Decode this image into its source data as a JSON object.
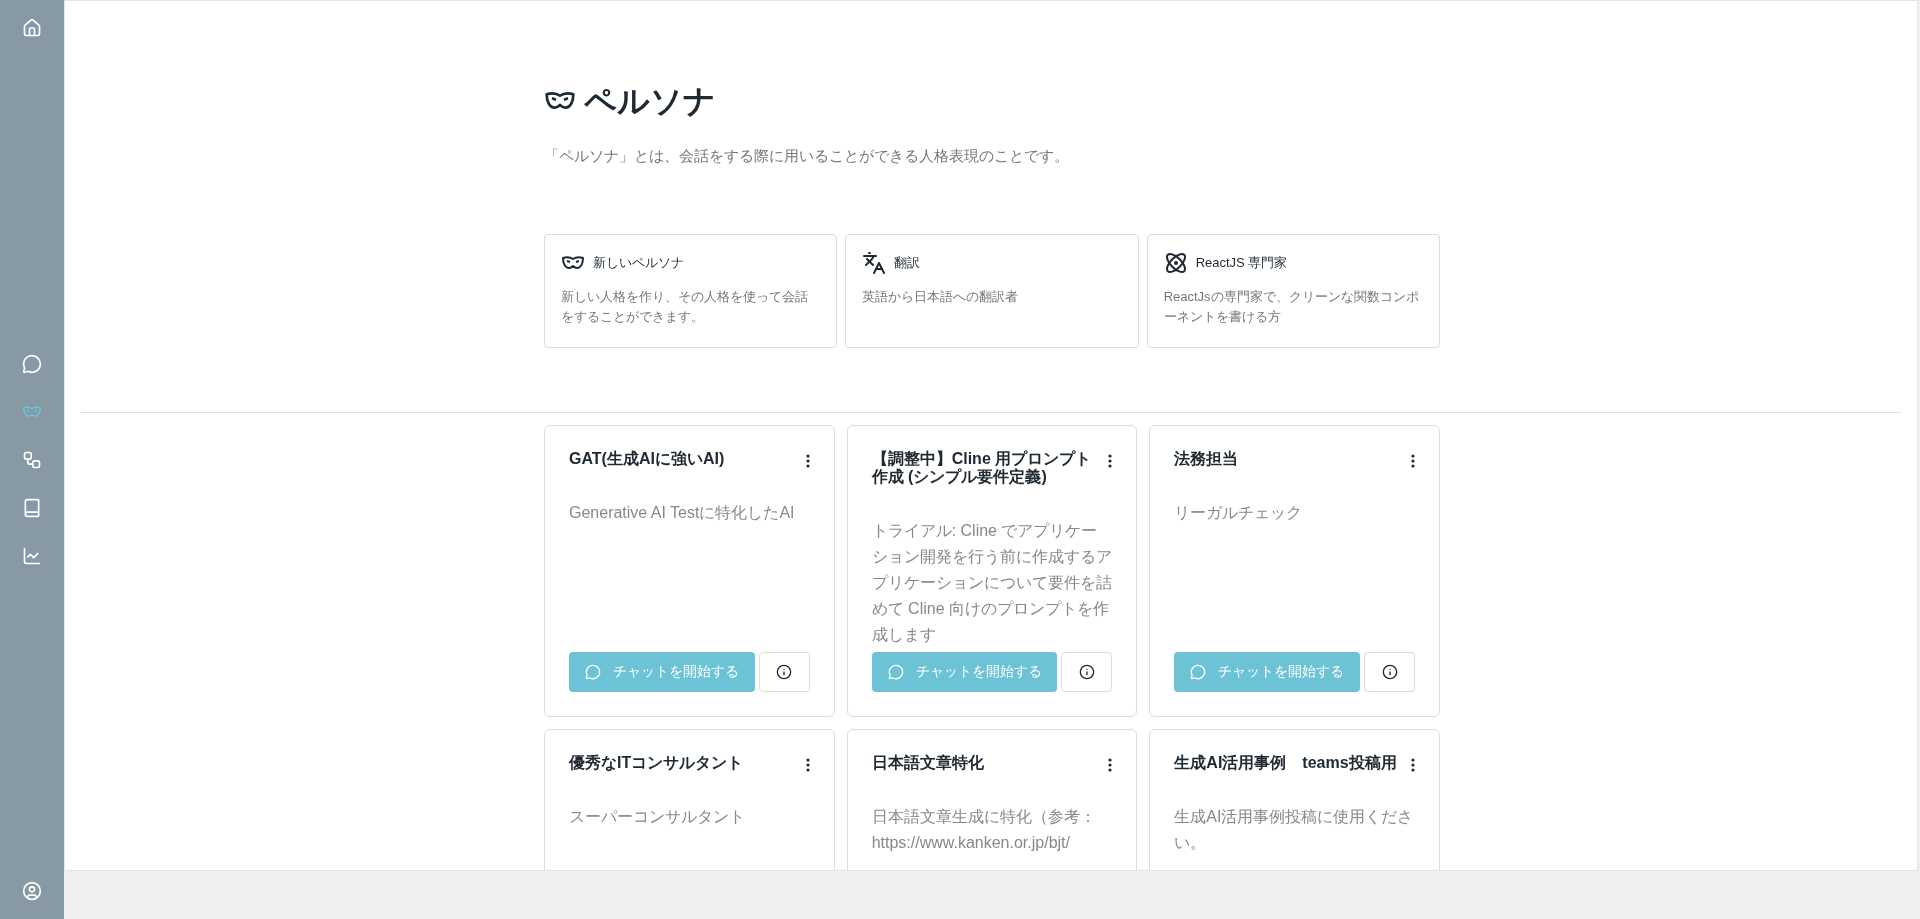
{
  "sidebar": {
    "top_items": [
      {
        "kind": "home",
        "selected": false
      }
    ],
    "items": [
      {
        "kind": "chat",
        "selected": false
      },
      {
        "kind": "persona",
        "selected": true
      },
      {
        "kind": "flow",
        "selected": false
      },
      {
        "kind": "book",
        "selected": false
      },
      {
        "kind": "chart",
        "selected": false
      }
    ],
    "bottom_items": [
      {
        "kind": "user",
        "selected": false
      }
    ]
  },
  "page": {
    "title": "ペルソナ",
    "description": "「ペルソナ」とは、会話をする際に用いることができる人格表現のことです。"
  },
  "templates": [
    {
      "kind": "persona",
      "title": "新しいペルソナ",
      "description": "新しい人格を作り、その人格を使って会話をすることができます。"
    },
    {
      "kind": "translate",
      "title": "翻訳",
      "description": "英語から日本語への翻訳者"
    },
    {
      "kind": "react",
      "title": "ReactJS 専門家",
      "description": "ReactJsの専門家で、クリーンな関数コンポーネントを書ける方"
    }
  ],
  "personas": [
    {
      "title": "GAT(生成AIに強いAI)",
      "description": "Generative AI Testに特化したAI",
      "button": "チャットを開始する"
    },
    {
      "title": "【調整中】Cline 用プロンプト作成 (シンプル要件定義)",
      "description": "トライアル: Cline でアプリケーション開発を行う前に作成するアプリケーションについて要件を詰めて Cline 向けのプロンプトを作成します",
      "button": "チャットを開始する"
    },
    {
      "title": "法務担当",
      "description": "リーガルチェック",
      "button": "チャットを開始する"
    },
    {
      "title": "優秀なITコンサルタント",
      "description": "スーパーコンサルタント"
    },
    {
      "title": "日本語文章特化",
      "description": "日本語文章生成に特化（参考：https://www.kanken.or.jp/bjt/"
    },
    {
      "title": "生成AI活用事例　teams投稿用",
      "description": "生成AI活用事例投稿に使用ください。"
    }
  ]
}
